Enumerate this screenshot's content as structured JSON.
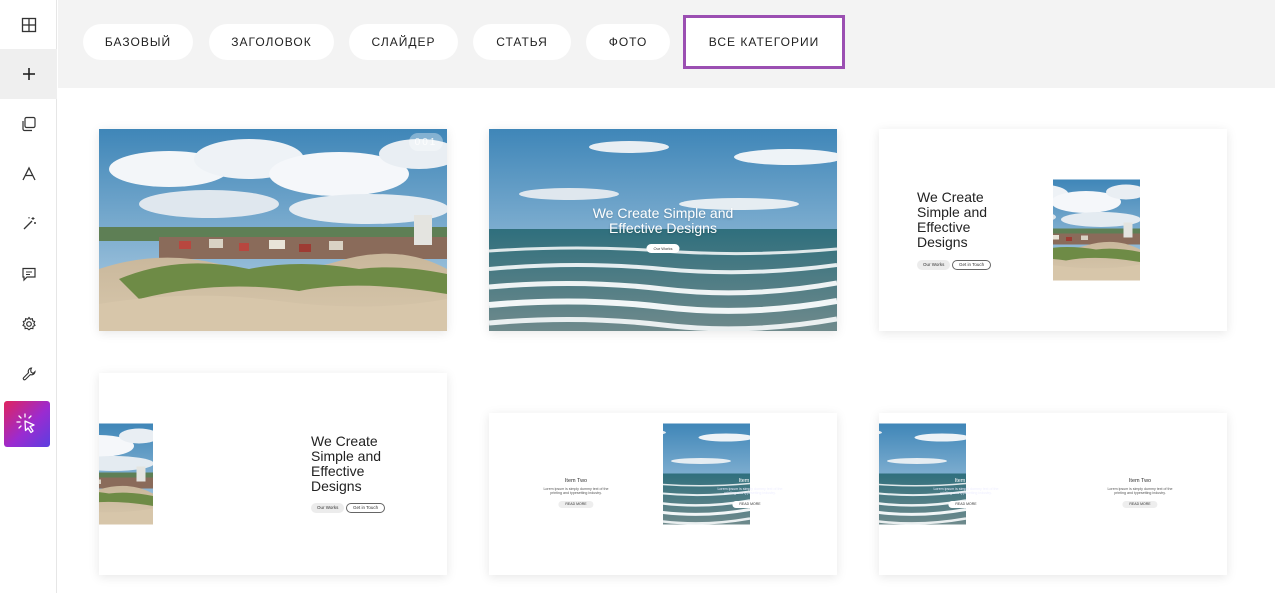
{
  "sidebar": {
    "items": [
      {
        "icon": "grid-icon"
      },
      {
        "icon": "plus-icon"
      },
      {
        "icon": "copy-icon"
      },
      {
        "icon": "font-icon"
      },
      {
        "icon": "magic-wand-icon"
      },
      {
        "icon": "comment-icon"
      },
      {
        "icon": "gear-icon"
      },
      {
        "icon": "wrench-icon"
      },
      {
        "icon": "cursor-click-icon"
      }
    ]
  },
  "categories": {
    "items": [
      "БАЗОВЫЙ",
      "ЗАГОЛОВОК",
      "СЛАЙДЕР",
      "СТАТЬЯ",
      "ФОТО",
      "ВСЕ КАТЕГОРИИ"
    ],
    "selected": "ВСЕ КАТЕГОРИИ"
  },
  "templates": [
    {
      "badge": "001"
    },
    {
      "title_line1": "We Create Simple and",
      "title_line2": "Effective Designs",
      "button": "Our Works"
    },
    {
      "title_lines": [
        "We Create",
        "Simple and",
        "Effective",
        "Designs"
      ],
      "btn1": "Our Works",
      "btn2": "Get in Touch"
    },
    {
      "title_lines": [
        "We Create",
        "Simple and",
        "Effective",
        "Designs"
      ],
      "btn1": "Our Works",
      "btn2": "Get in Touch"
    },
    {
      "left_title": "Item Two",
      "left_desc": "Lorem ipsum is simply dummy text of the printing and typesetting industry.",
      "left_btn": "READ MORE",
      "right_title": "Item One",
      "right_desc": "Lorem ipsum is simply dummy text of the printing and typesetting industry.",
      "right_btn": "READ MORE"
    },
    {
      "left_title": "Item One",
      "left_desc": "Lorem ipsum is simply dummy text of the printing and typesetting industry.",
      "left_btn": "READ MORE",
      "right_title": "Item Two",
      "right_desc": "Lorem ipsum is simply dummy text of the printing and typesetting industry.",
      "right_btn": "READ MORE"
    }
  ],
  "colors": {
    "accent_border": "#9b4fb2",
    "topbar_bg": "#f3f3f3",
    "special_gradient_from": "#e0245e",
    "special_gradient_to": "#5b3fe0"
  }
}
